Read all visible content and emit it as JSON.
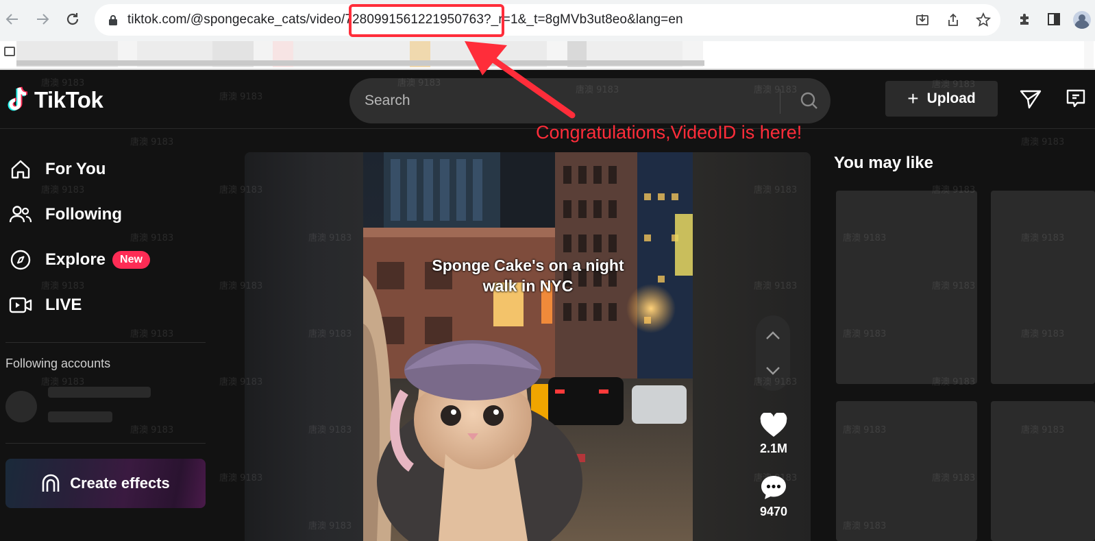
{
  "browser": {
    "url": "tiktok.com/@spongecake_cats/video/7280991561221950763?_r=1&_t=8gMVb3ut8eo&lang=en",
    "back_icon": "arrow-left-icon",
    "forward_icon": "arrow-right-icon",
    "reload_icon": "reload-icon"
  },
  "annotation": {
    "text": "Congratulations,VideoID is here!",
    "color": "#ff2d3a"
  },
  "header": {
    "logo_text": "TikTok",
    "search_placeholder": "Search",
    "upload_label": "Upload"
  },
  "sidebar": {
    "items": [
      {
        "label": "For You",
        "icon": "home-icon"
      },
      {
        "label": "Following",
        "icon": "people-icon"
      },
      {
        "label": "Explore",
        "icon": "compass-icon",
        "badge": "New"
      },
      {
        "label": "LIVE",
        "icon": "live-camera-icon"
      }
    ],
    "following_title": "Following accounts",
    "effects_label": "Create effects"
  },
  "video": {
    "caption_line1": "Sponge Cake's on a night",
    "caption_line2": "walk in NYC",
    "likes": "2.1M",
    "comments": "9470"
  },
  "right": {
    "title": "You may like"
  },
  "watermark": "唐澳 9183",
  "colors": {
    "accent_pink": "#fe2c55",
    "background": "#121212"
  }
}
